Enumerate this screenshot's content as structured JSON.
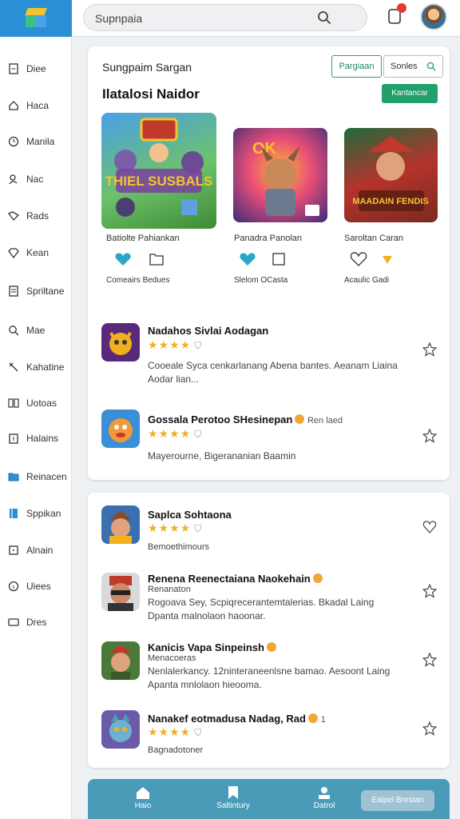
{
  "search": {
    "placeholder": "Supnpaia"
  },
  "sidebar": {
    "items": [
      {
        "label": "Diee",
        "icon": "document-icon"
      },
      {
        "label": "Haca",
        "icon": "home-icon"
      },
      {
        "label": "Manila",
        "icon": "clock-icon"
      },
      {
        "label": "Nac",
        "icon": "user-icon"
      },
      {
        "label": "Rads",
        "icon": "tag-icon"
      },
      {
        "label": "Kean",
        "icon": "gem-icon"
      },
      {
        "label": "Spriltane",
        "icon": "list-icon"
      },
      {
        "label": "Mae",
        "icon": "search-icon"
      },
      {
        "label": "Kahatine",
        "icon": "tool-icon"
      },
      {
        "label": "Uotoas",
        "icon": "grid-icon"
      },
      {
        "label": "Halains",
        "icon": "calendar-icon"
      },
      {
        "label": "Reinacen",
        "icon": "folder-icon"
      },
      {
        "label": "Sppikan",
        "icon": "book-icon"
      },
      {
        "label": "Alnain",
        "icon": "box-icon"
      },
      {
        "label": "Uiees",
        "icon": "info-icon"
      },
      {
        "label": "Dres",
        "icon": "chat-icon"
      }
    ]
  },
  "panel1": {
    "section_title": "Sungpaim Sargan",
    "seg_a": "Pargiaan",
    "seg_b": "Sonles",
    "heading": "Ilatalosi Naidor",
    "green_button": "Kantancar",
    "featured": [
      {
        "title": "Batiolte Pahiankan",
        "footer": "Comeairs Bedues",
        "img_text": "THIEL SUSBALS"
      },
      {
        "title": "Panadra Panolan",
        "footer": "Slelom OCasta",
        "img_text": "OK"
      },
      {
        "title": "Saroltan Caran",
        "footer": "Acaulic Gadi",
        "img_text": "MAADAIN FENDIS"
      }
    ],
    "list": [
      {
        "title": "Nadahos Sivlai Aodagan",
        "desc": "Cooeale Syca cenkarlanang Abena bantes. Aeanam Liaina Aodar lian...",
        "rating": 4
      },
      {
        "title": "Gossala Perotoo SHesinepan",
        "tag": "Ren laed",
        "desc": "Mayerourne, Bigerananian Baamin",
        "rating": 4
      }
    ]
  },
  "panel2": {
    "list": [
      {
        "title": "Saplca Sohtaona",
        "sub": "Bemoethimours",
        "rating": 4
      },
      {
        "title": "Renena Reenectaiana Naokehain",
        "sub": "Renanaton",
        "desc": "Rogoava Sey,  Scpiqrecerantemtalerias. Bkadal Laing Dpanta malnolaon haoonar.",
        "rating": 0
      },
      {
        "title": "Kanicis Vapa Sinpeinsh",
        "sub": "Menacoeras",
        "desc": "Nenlalerkancy. 12ninteraneenlsne bamao. Aesoont Laing Apanta mnlolaon hieooma.",
        "rating": 0
      },
      {
        "title": "Nanakef eotmadusa Nadag, Rad",
        "tag": "1",
        "sub": "Bagnadotoner",
        "rating": 4
      }
    ]
  },
  "bottom_nav": {
    "items": [
      {
        "label": "Haio",
        "icon": "home-icon"
      },
      {
        "label": "Saltintury",
        "icon": "bookmark-icon"
      },
      {
        "label": "Datrol",
        "icon": "profile-icon"
      }
    ],
    "button": "Eaipel Bnrstan"
  },
  "colors": {
    "accent_blue": "#2b8fd6",
    "accent_green": "#22a06b",
    "nav_bg": "#4a9bb8",
    "star": "#f2b01e"
  }
}
